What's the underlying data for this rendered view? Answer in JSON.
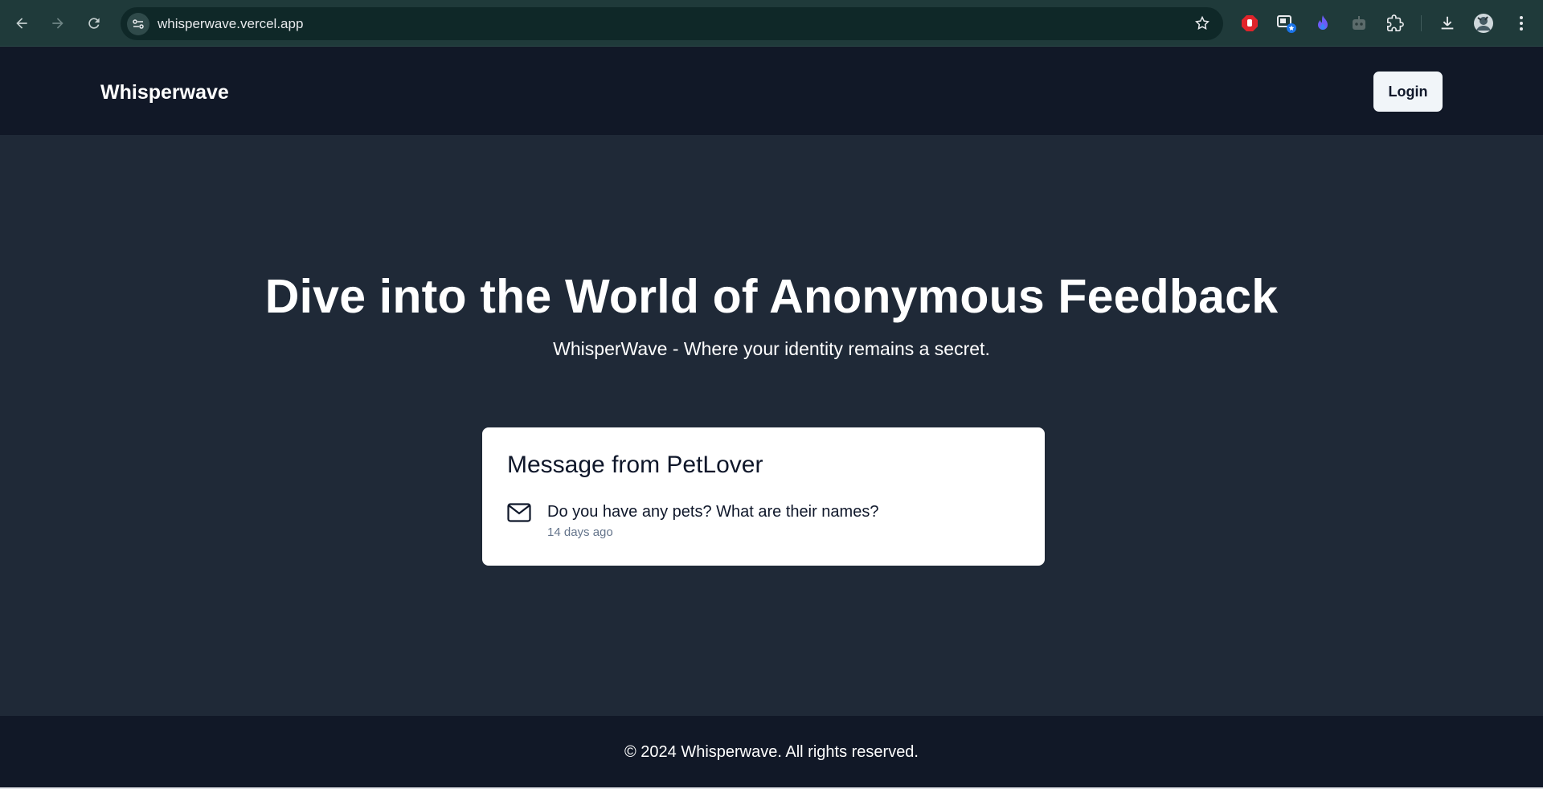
{
  "browser": {
    "url": "whisperwave.vercel.app",
    "icons": [
      "back-icon",
      "forward-icon",
      "reload-icon",
      "site-info-icon",
      "bookmark-star-icon",
      "adblock-extension-icon",
      "tab-search-extension-icon",
      "flame-extension-icon",
      "robot-extension-icon",
      "extensions-puzzle-icon",
      "downloads-icon",
      "profile-avatar",
      "more-menu-icon"
    ]
  },
  "header": {
    "brand": "Whisperwave",
    "login_label": "Login"
  },
  "hero": {
    "title": "Dive into the World of Anonymous Feedback",
    "subtitle": "WhisperWave - Where your identity remains a secret."
  },
  "message_card": {
    "title": "Message from PetLover",
    "icon": "mail-icon",
    "content": "Do you have any pets? What are their names?",
    "time": "14 days ago"
  },
  "footer": {
    "text": "© 2024 Whisperwave. All rights reserved."
  },
  "colors": {
    "header_bg": "#111827",
    "main_bg": "#1f2937",
    "card_bg": "#ffffff",
    "browser_bar": "#1f3a3a"
  }
}
